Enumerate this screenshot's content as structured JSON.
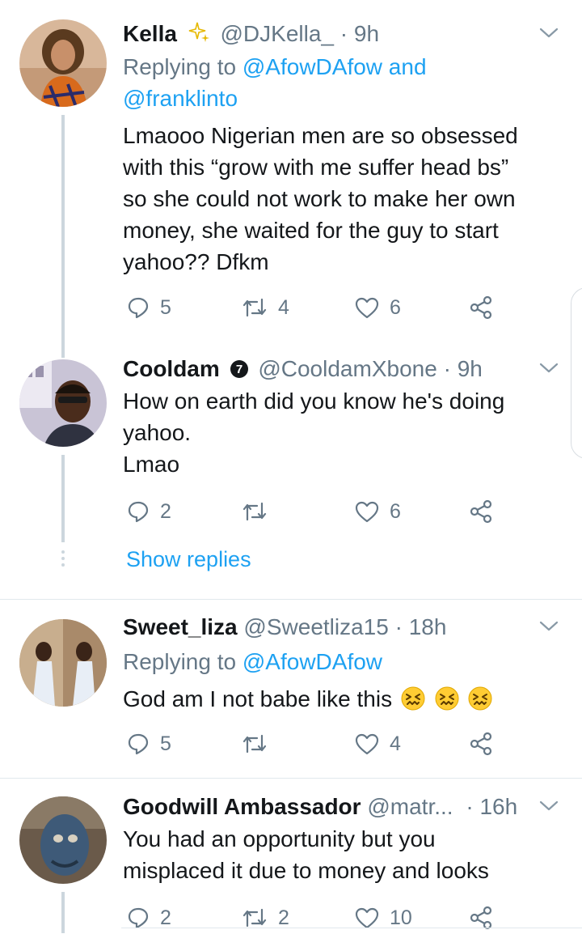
{
  "tweets": [
    {
      "name": "Kella",
      "handle": "@DJKella_",
      "dot": "·",
      "time": "9h",
      "reply_prefix": "Replying to",
      "reply_user1": "@AfowDAfow",
      "reply_and": "and",
      "reply_user2": "@franklinto",
      "lines": [
        "Lmaooo Nigerian men are so obsessed",
        "with this “grow with me suffer head bs”",
        "so she could not work to make her own",
        "money, she waited for the guy to start",
        "yahoo?? Dfkm"
      ],
      "replies": "5",
      "retweets": "4",
      "likes": "6"
    },
    {
      "name": "Cooldam",
      "badge": "7",
      "handle": "@CooldamXbone",
      "dot": "·",
      "time": "9h",
      "lines": [
        "How on earth did you know he's doing",
        "yahoo.",
        "Lmao"
      ],
      "replies": "2",
      "retweets": "",
      "likes": "6",
      "show_replies": "Show replies"
    },
    {
      "name": "Sweet_liza",
      "handle": "@Sweetliza15",
      "dot": "·",
      "time": "18h",
      "reply_prefix": "Replying to",
      "reply_user1": "@AfowDAfow",
      "text": "God am I not babe like this",
      "replies": "5",
      "retweets": "",
      "likes": "4"
    },
    {
      "name": "Goodwill Ambassador",
      "handle": "@matr...",
      "dot": "·",
      "time": "16h",
      "lines": [
        "You had an opportunity but you",
        "misplaced it due to money and looks"
      ],
      "replies": "2",
      "retweets": "2",
      "likes": "10"
    }
  ],
  "colors": {
    "link": "#1da1f2",
    "muted": "#657786",
    "line": "#ccd6dd"
  }
}
